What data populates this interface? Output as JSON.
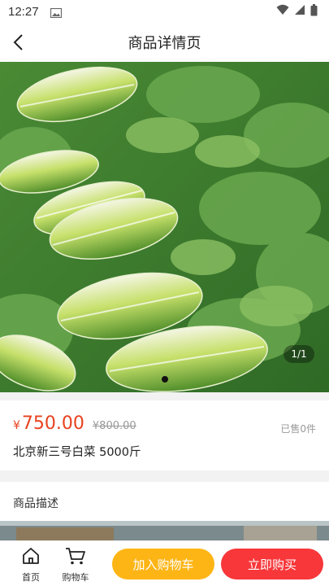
{
  "status_bar": {
    "time": "12:27",
    "icons": [
      "gallery-icon",
      "wifi-icon",
      "signal-icon",
      "battery-icon"
    ]
  },
  "nav": {
    "title": "商品详情页",
    "back_icon": "chevron-left-icon"
  },
  "gallery": {
    "counter": "1/1",
    "dots": 1,
    "active_dot": 1
  },
  "product": {
    "currency": "¥",
    "price": "750.00",
    "original_price": "¥800.00",
    "sold": "已售0件",
    "name": "北京新三号白菜 5000斤"
  },
  "description": {
    "title": "商品描述"
  },
  "bottom_bar": {
    "home_label": "首页",
    "cart_label": "购物车",
    "add_to_cart": "加入购物车",
    "buy_now": "立即购买"
  },
  "colors": {
    "price": "#e8421f",
    "add_to_cart_bg": "#fdb516",
    "buy_now_bg": "#f7373a"
  }
}
